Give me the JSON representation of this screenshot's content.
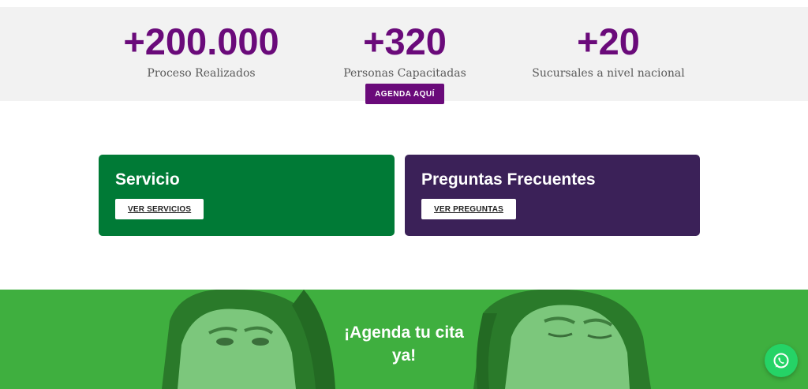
{
  "stats": [
    {
      "number": "+200.000",
      "label": "Proceso Realizados"
    },
    {
      "number": "+320",
      "label": "Personas Capacitadas"
    },
    {
      "number": "+20",
      "label": "Sucursales a nivel nacional"
    }
  ],
  "cards": {
    "servicio": {
      "title": "Servicio",
      "button": "VER SERVICIOS"
    },
    "preguntas": {
      "title": "Preguntas Frecuentes",
      "button": "VER PREGUNTAS"
    }
  },
  "promo": {
    "title_line1": "¡Agenda tu cita",
    "title_line2": "ya!",
    "button": "AGENDA AQUÍ"
  },
  "colors": {
    "accent_purple": "#6a0a7a",
    "card_green": "#007a36",
    "card_purple": "#3b2158",
    "promo_green": "#3faf3f",
    "whatsapp_green": "#25d366"
  },
  "icons": {
    "floating": "whatsapp-icon"
  }
}
